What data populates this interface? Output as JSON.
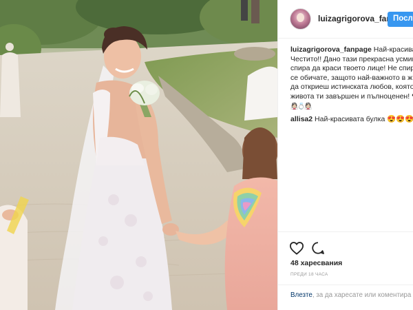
{
  "post": {
    "username": "luizagrigorova_fanp",
    "follow_label": "После",
    "caption": {
      "user": "luizagrigorova_fanpage",
      "lines": [
        "Най-красивата",
        "Честито!! Дано тази прекрасна усмив",
        "спира да краси твоето лице! Не спира",
        "се обичате, защото най-важното в ж",
        "да откриеш истинската любов, която",
        "живота ти завършен и пълноценен! ❤",
        "👰🏻💍👰🏻"
      ]
    },
    "comment": {
      "user": "allisa2",
      "text": "Най-красивата булка 😍😍😍😍"
    },
    "likes": "48 харесвания",
    "time": "ПРЕДИ 18 ЧАСА",
    "login": {
      "link": "Влезте",
      "text": ", за да харесате или коментира"
    }
  },
  "icons": {
    "like": "heart-icon",
    "comment": "comment-bubble-icon"
  },
  "colors": {
    "follow_button": "#3897f0",
    "text": "#262626",
    "muted": "#999999",
    "border": "#efefef"
  }
}
